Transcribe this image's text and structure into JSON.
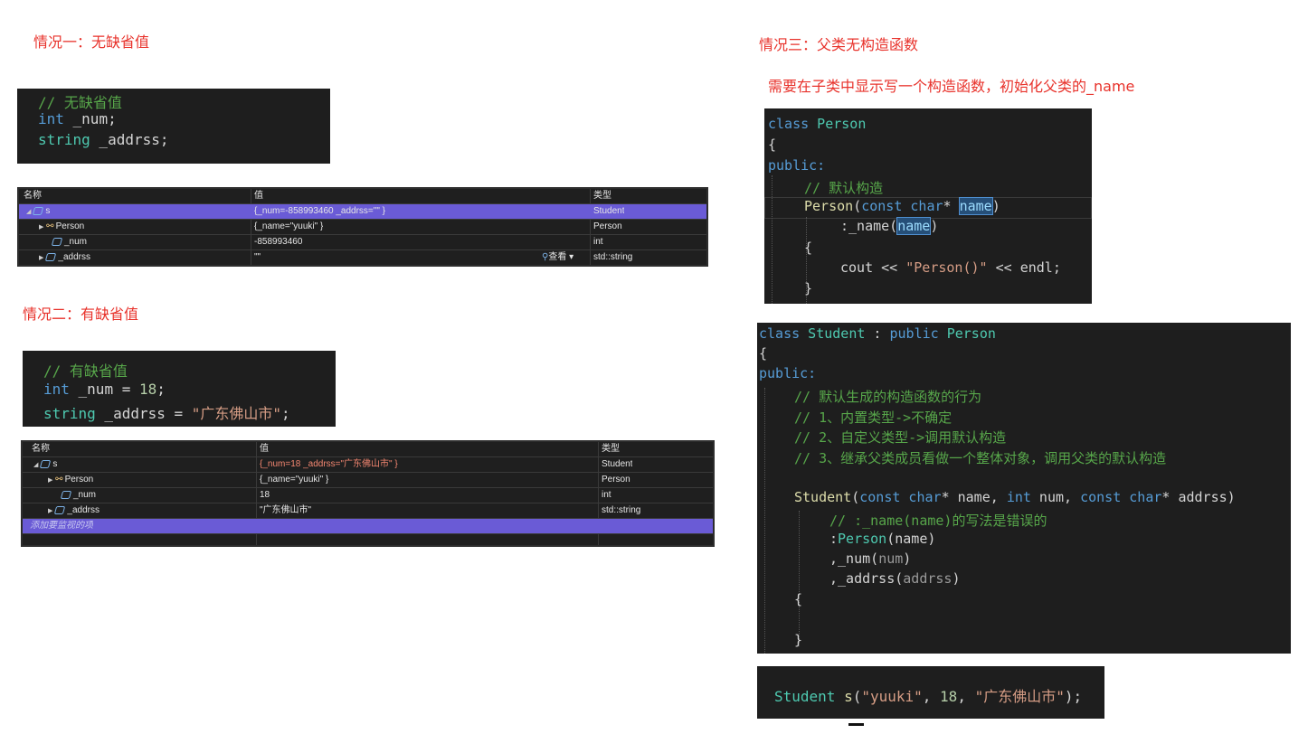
{
  "headings": {
    "case1": "情况一：无缺省值",
    "case2": "情况二：有缺省值",
    "case3": "情况三：父类无构造函数",
    "case3_note": "需要在子类中显示写一个构造函数，初始化父类的_name"
  },
  "code1": {
    "comment": "// 无缺省值",
    "line2_type": "int",
    "line2_name": " _num;",
    "line3_type": "string",
    "line3_name": " _addrss;"
  },
  "watch1": {
    "headers": [
      "名称",
      "值",
      "类型"
    ],
    "rows": [
      {
        "name": "s",
        "value": "{_num=-858993460 _addrss=\"\" }",
        "type": "Student"
      },
      {
        "name": "Person",
        "value": "{_name=\"yuuki\" }",
        "type": "Person"
      },
      {
        "name": "_num",
        "value": "-858993460",
        "type": "int"
      },
      {
        "name": "_addrss",
        "value": "\"\"",
        "type": "std::string"
      }
    ],
    "view_label": "查看"
  },
  "code2": {
    "comment": "// 有缺省值",
    "line2_type": "int",
    "line2_name": " _num = ",
    "line2_value": "18",
    "line2_end": ";",
    "line3_type": "string",
    "line3_name": " _addrss = ",
    "line3_value": "\"广东佛山市\"",
    "line3_end": ";"
  },
  "watch2": {
    "headers": [
      "名称",
      "值",
      "类型"
    ],
    "rows": [
      {
        "name": "s",
        "value": "{_num=18 _addrss=\"广东佛山市\" }",
        "type": "Student"
      },
      {
        "name": "Person",
        "value": "{_name=\"yuuki\" }",
        "type": "Person"
      },
      {
        "name": "_num",
        "value": "18",
        "type": "int"
      },
      {
        "name": "_addrss",
        "value": "\"广东佛山市\"",
        "type": "std::string"
      }
    ],
    "add_watch": "添加要监视的项"
  },
  "code3": {
    "class_kw": "class",
    "class_name": " Person",
    "open_brace": "{",
    "public_kw": "public:",
    "comment": "// 默认构造",
    "ctor_name": "Person",
    "ctor_open": "(",
    "const_kw": "const",
    "char_kw": " char",
    "star": "* ",
    "param": "name",
    "ctor_close": ")",
    "init_prefix": ":_name(",
    "init_param": "name",
    "init_close": ")",
    "brace_open": "{",
    "cout": "cout << ",
    "cout_str": "\"Person()\"",
    "cout_mid": " << ",
    "endl": "endl",
    "semicolon": ";",
    "brace_close": "}"
  },
  "code4": {
    "class_kw": "class",
    "class_name": " Student",
    "colon": " : ",
    "public_kw": "public",
    "base": " Person",
    "open_brace": "{",
    "access": "public:",
    "comments": [
      "// 默认生成的构造函数的行为",
      "// 1、内置类型->不确定",
      "// 2、自定义类型->调用默认构造",
      "// 3、继承父类成员看做一个整体对象，调用父类的默认构造"
    ],
    "ctor_name": "Student",
    "ctor_params": [
      "(",
      "const",
      " char",
      "* name, ",
      "int",
      " num, ",
      "const",
      " char",
      "* addrss)"
    ],
    "err_comment": "// :_name(name)的写法是错误的",
    "init1_a": ":",
    "init1_b": "Person",
    "init1_c": "(name)",
    "init2_a": ",_num(",
    "init2_b": "num",
    "init2_c": ")",
    "init3_a": ",_addrss(",
    "init3_b": "addrss",
    "init3_c": ")",
    "brace_open": "{",
    "brace_close": "}"
  },
  "code5": {
    "type": "Student",
    "var": " s",
    "open": "(",
    "arg1": "\"yuuki\"",
    "sep1": ", ",
    "arg2": "18",
    "sep2": ", ",
    "arg3": "\"广东佛山市\"",
    "close": ");"
  }
}
